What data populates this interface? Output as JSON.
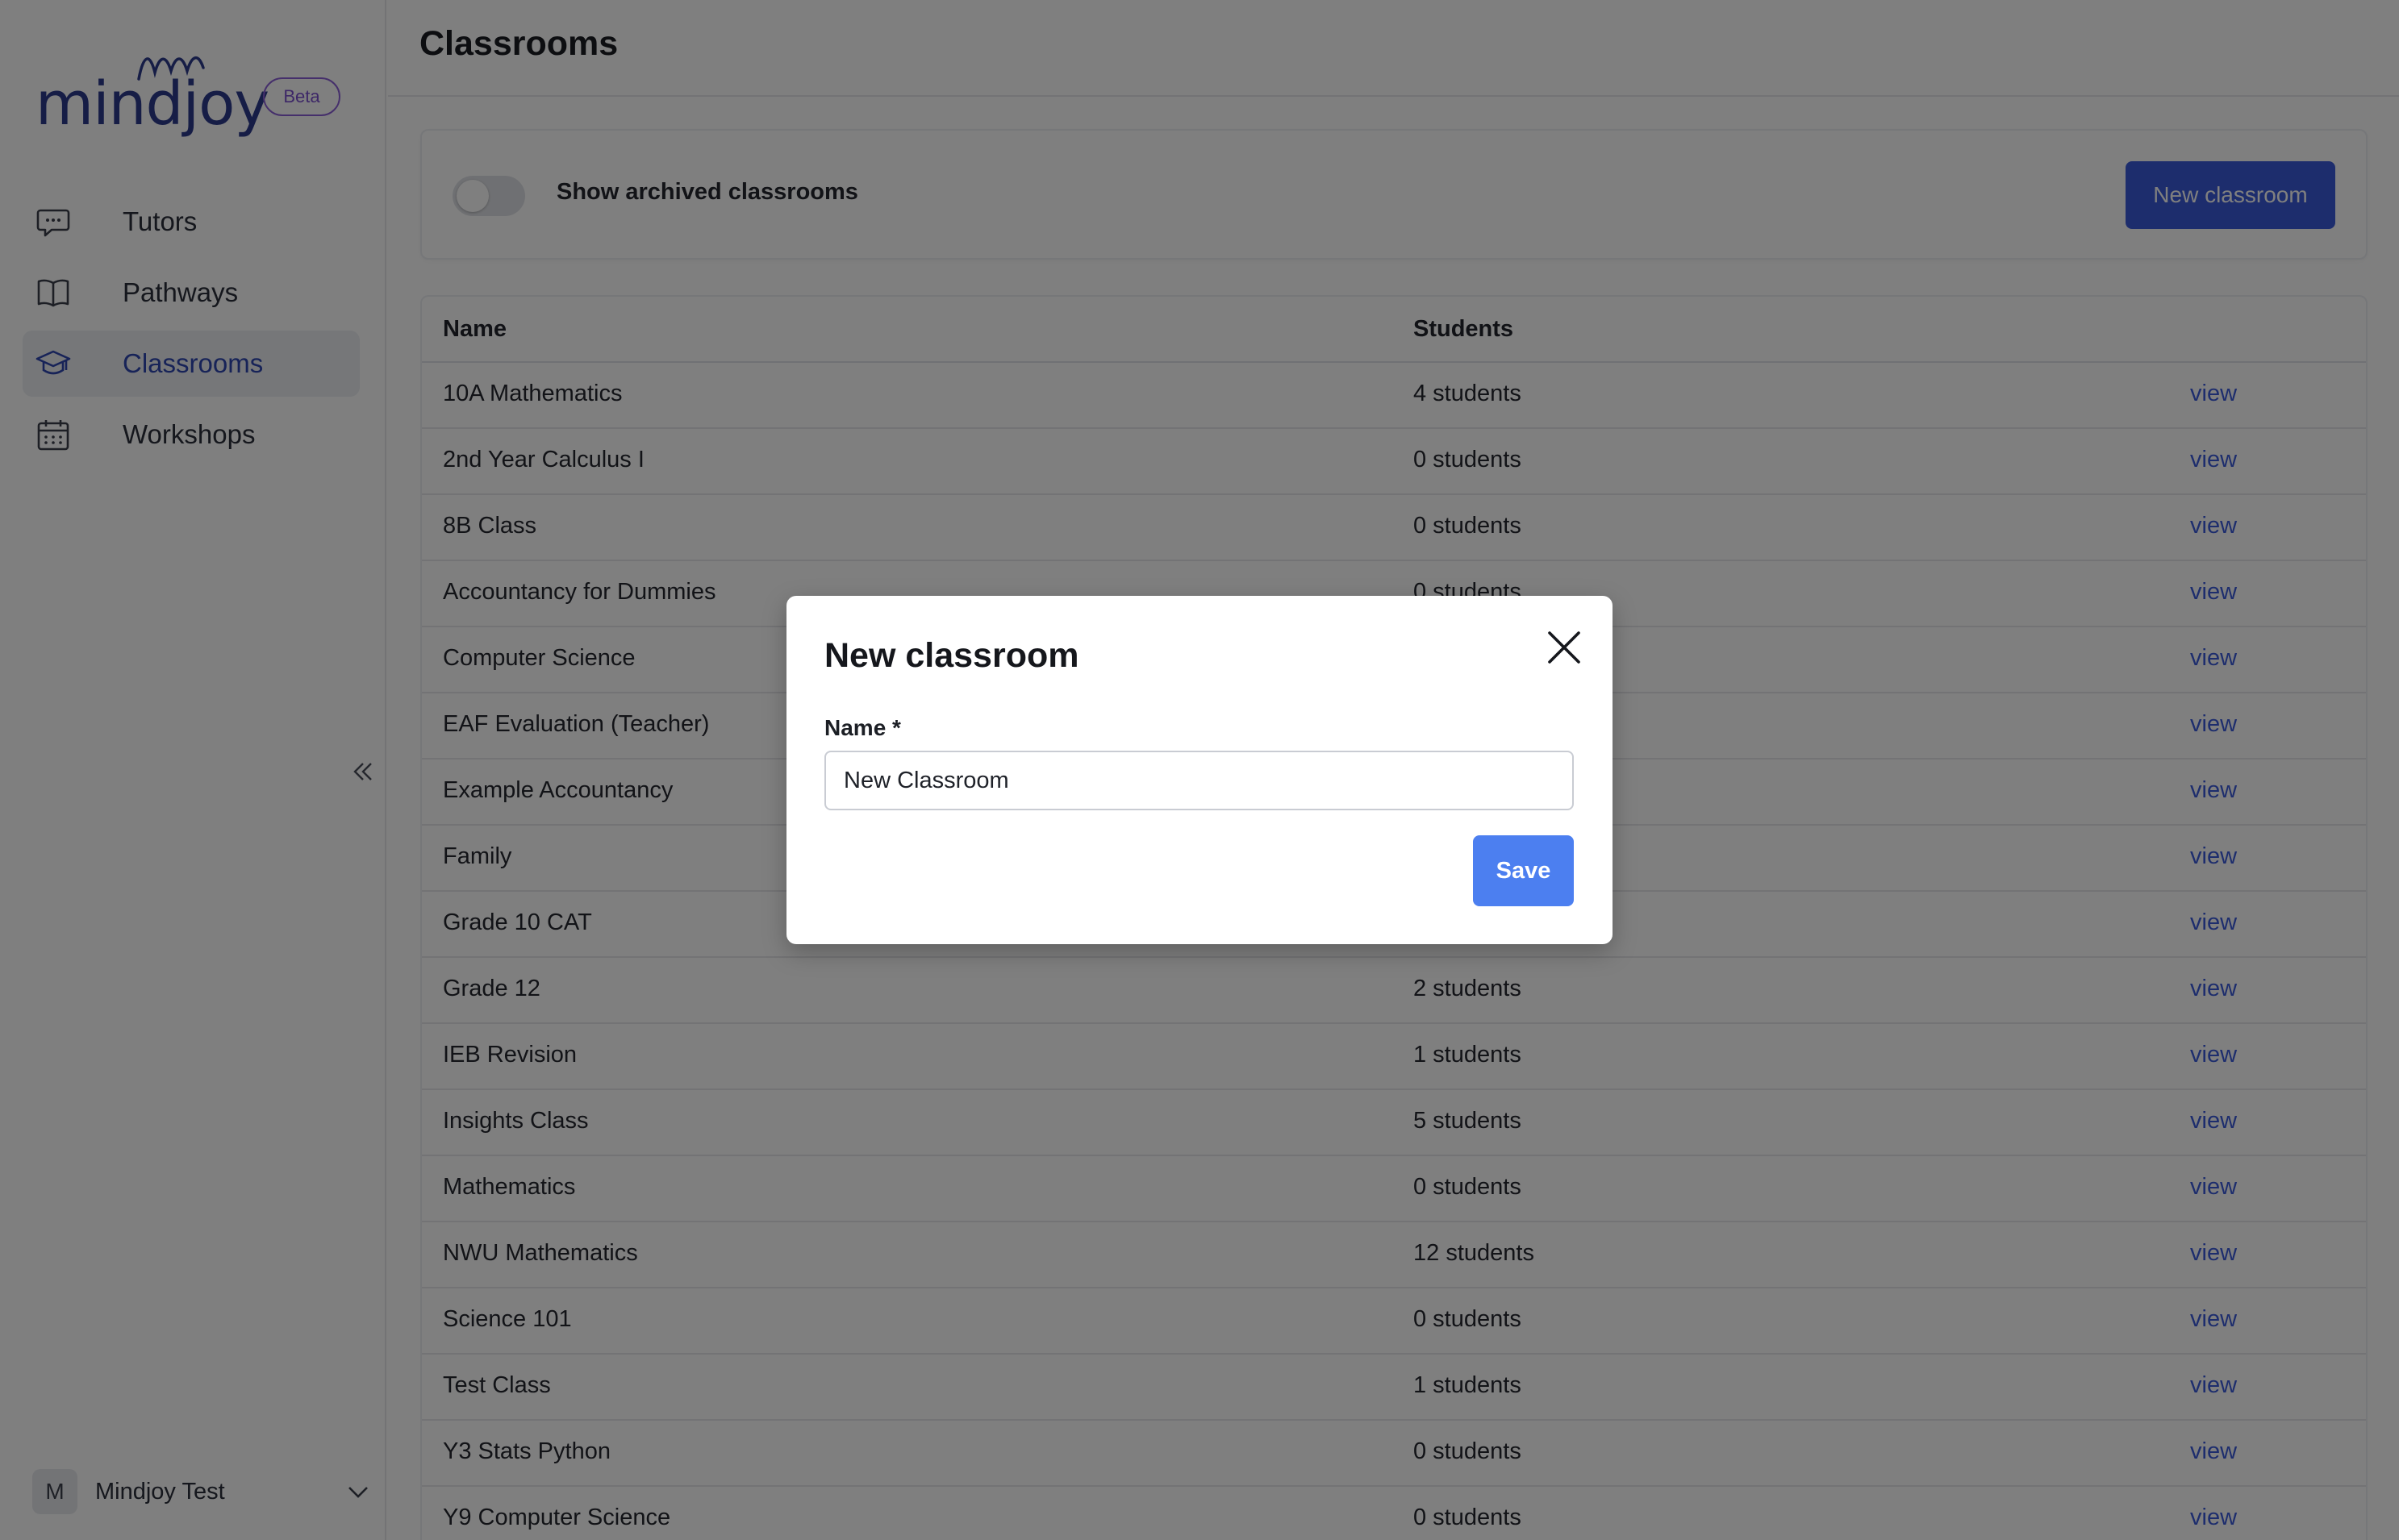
{
  "app": {
    "logo_text": "mindjoy",
    "beta_badge": "Beta"
  },
  "sidebar": {
    "items": [
      {
        "label": "Tutors",
        "icon": "chat-bubble-icon",
        "active": false
      },
      {
        "label": "Pathways",
        "icon": "book-icon",
        "active": false
      },
      {
        "label": "Classrooms",
        "icon": "graduation-cap-icon",
        "active": true
      },
      {
        "label": "Workshops",
        "icon": "calendar-icon",
        "active": false
      }
    ],
    "collapse_icon": "double-chevron-left-icon",
    "user": {
      "initial": "M",
      "name": "Mindjoy Test",
      "menu_icon": "chevron-down-icon"
    }
  },
  "header": {
    "title": "Classrooms"
  },
  "toolbar": {
    "toggle_label": "Show archived classrooms",
    "toggle_on": false,
    "new_button_label": "New classroom"
  },
  "table": {
    "columns": [
      "Name",
      "Students"
    ],
    "view_label": "view",
    "rows": [
      {
        "name": "10A Mathematics",
        "students": "4 students"
      },
      {
        "name": "2nd Year Calculus I",
        "students": "0 students"
      },
      {
        "name": "8B Class",
        "students": "0 students"
      },
      {
        "name": "Accountancy for Dummies",
        "students": "0 students"
      },
      {
        "name": "Computer Science",
        "students": ""
      },
      {
        "name": "EAF Evaluation (Teacher)",
        "students": ""
      },
      {
        "name": "Example Accountancy",
        "students": ""
      },
      {
        "name": "Family",
        "students": ""
      },
      {
        "name": "Grade 10 CAT",
        "students": ""
      },
      {
        "name": "Grade 12",
        "students": "2 students"
      },
      {
        "name": "IEB Revision",
        "students": "1 students"
      },
      {
        "name": "Insights Class",
        "students": "5 students"
      },
      {
        "name": "Mathematics",
        "students": "0 students"
      },
      {
        "name": "NWU Mathematics",
        "students": "12 students"
      },
      {
        "name": "Science 101",
        "students": "0 students"
      },
      {
        "name": "Test Class",
        "students": "1 students"
      },
      {
        "name": "Y3 Stats Python",
        "students": "0 students"
      },
      {
        "name": "Y9 Computer Science",
        "students": "0 students"
      }
    ]
  },
  "modal": {
    "title": "New classroom",
    "field_label": "Name *",
    "field_value": "New Classroom",
    "save_label": "Save",
    "close_icon": "close-icon"
  },
  "colors": {
    "accent": "#3b5bdb",
    "save_button": "#4c7ff0",
    "beta_border": "#8b5fd6",
    "overlay": "rgba(0,0,0,0.5)"
  }
}
